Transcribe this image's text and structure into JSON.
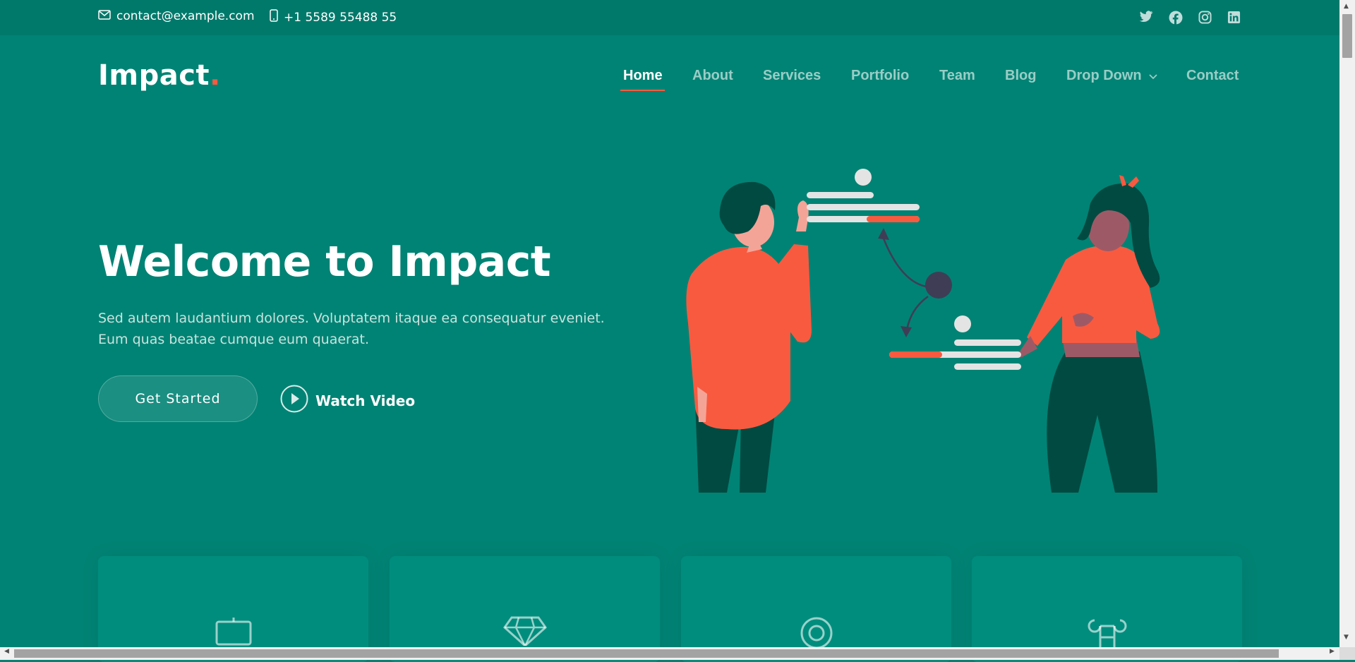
{
  "topbar": {
    "email": "contact@example.com",
    "phone": "+1 5589 55488 55",
    "social_icons": [
      "twitter-icon",
      "facebook-icon",
      "instagram-icon",
      "linkedin-icon"
    ]
  },
  "header": {
    "logo": "Impact",
    "logo_dot": ".",
    "nav": [
      "Home",
      "About",
      "Services",
      "Portfolio",
      "Team",
      "Blog",
      "Drop Down",
      "Contact"
    ],
    "active_nav": "Home"
  },
  "hero": {
    "title": "Welcome to Impact",
    "text": "Sed autem laudantium dolores. Voluptatem itaque ea consequatur eveniet. Eum quas beatae cumque eum quaerat.",
    "cta": "Get Started",
    "video": "Watch Video"
  },
  "cards": [
    {
      "icon": "easel-icon"
    },
    {
      "icon": "gem-icon"
    },
    {
      "icon": "target-icon"
    },
    {
      "icon": "command-icon"
    }
  ],
  "colors": {
    "background": "#008374",
    "topbar": "#00796b",
    "accent": "#f85a40"
  }
}
